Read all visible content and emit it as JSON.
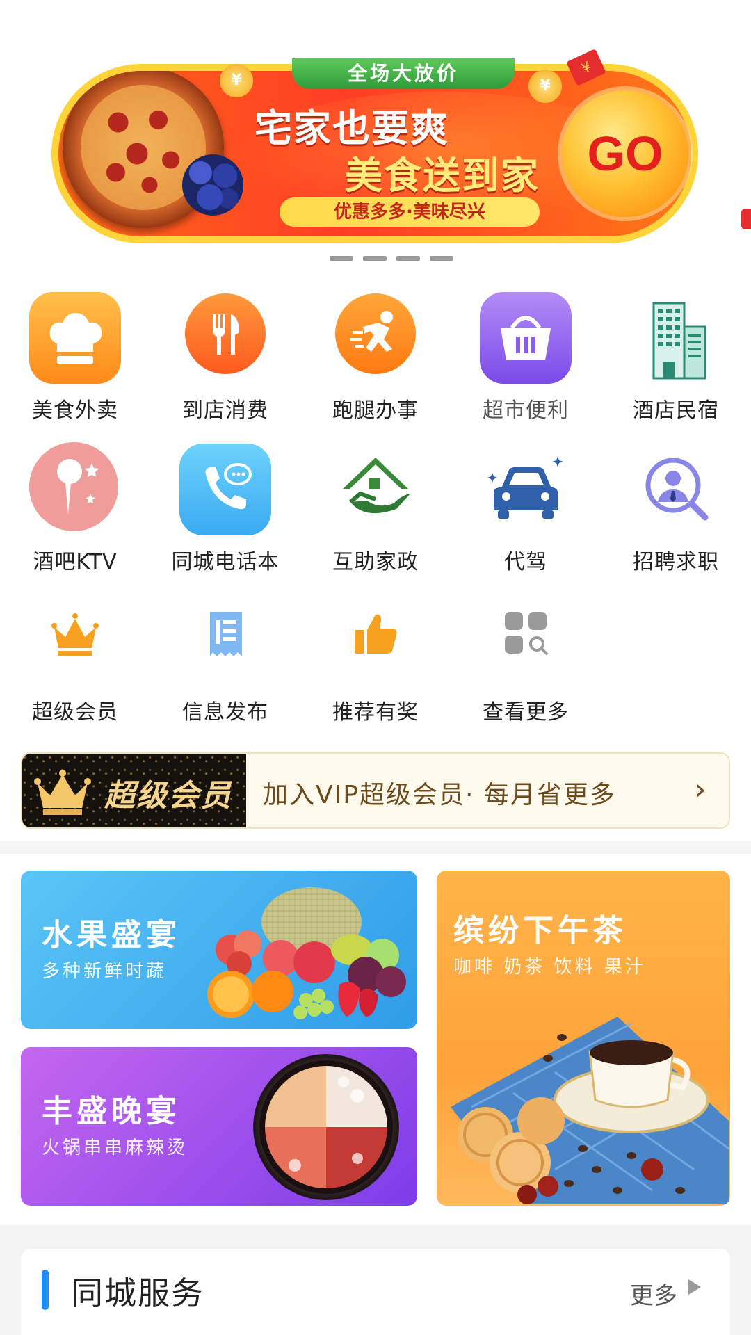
{
  "banner": {
    "top_tag": "全场大放价",
    "title_line1": "宅家也要爽",
    "title_line2": "美食送到家",
    "subtitle": "优惠多多·美味尽兴",
    "go_label": "GO",
    "coin_symbol": "¥",
    "page_count": 4,
    "colors": {
      "accent": "#ff3d24",
      "border": "#ffd43a",
      "tag": "#2f9b3a"
    }
  },
  "services": [
    {
      "label": "美食外卖",
      "icon": "chef-hat-icon"
    },
    {
      "label": "到店消费",
      "icon": "fork-knife-icon"
    },
    {
      "label": "跑腿办事",
      "icon": "runner-icon"
    },
    {
      "label": "超市便利",
      "icon": "shopping-basket-icon"
    },
    {
      "label": "酒店民宿",
      "icon": "hotel-building-icon"
    },
    {
      "label": "酒吧KTV",
      "icon": "microphone-icon"
    },
    {
      "label": "同城电话本",
      "icon": "phone-chat-icon"
    },
    {
      "label": "互助家政",
      "icon": "house-hand-icon"
    },
    {
      "label": "代驾",
      "icon": "car-icon"
    },
    {
      "label": "招聘求职",
      "icon": "job-search-icon"
    },
    {
      "label": "超级会员",
      "icon": "crown-icon"
    },
    {
      "label": "信息发布",
      "icon": "document-icon"
    },
    {
      "label": "推荐有奖",
      "icon": "thumbs-up-icon"
    },
    {
      "label": "查看更多",
      "icon": "more-grid-icon"
    }
  ],
  "vip": {
    "badge": "超级会员",
    "text": "加入VIP超级会员· 每月省更多",
    "arrow": "›"
  },
  "promos": {
    "fruit": {
      "title": "水果盛宴",
      "subtitle": "多种新鲜时蔬"
    },
    "dinner": {
      "title": "丰盛晚宴",
      "subtitle": "火锅串串麻辣烫"
    },
    "tea": {
      "title": "缤纷下午茶",
      "subtitle": "咖啡 奶茶 饮料 果汁"
    }
  },
  "city_service": {
    "title": "同城服务",
    "more": "更多"
  }
}
